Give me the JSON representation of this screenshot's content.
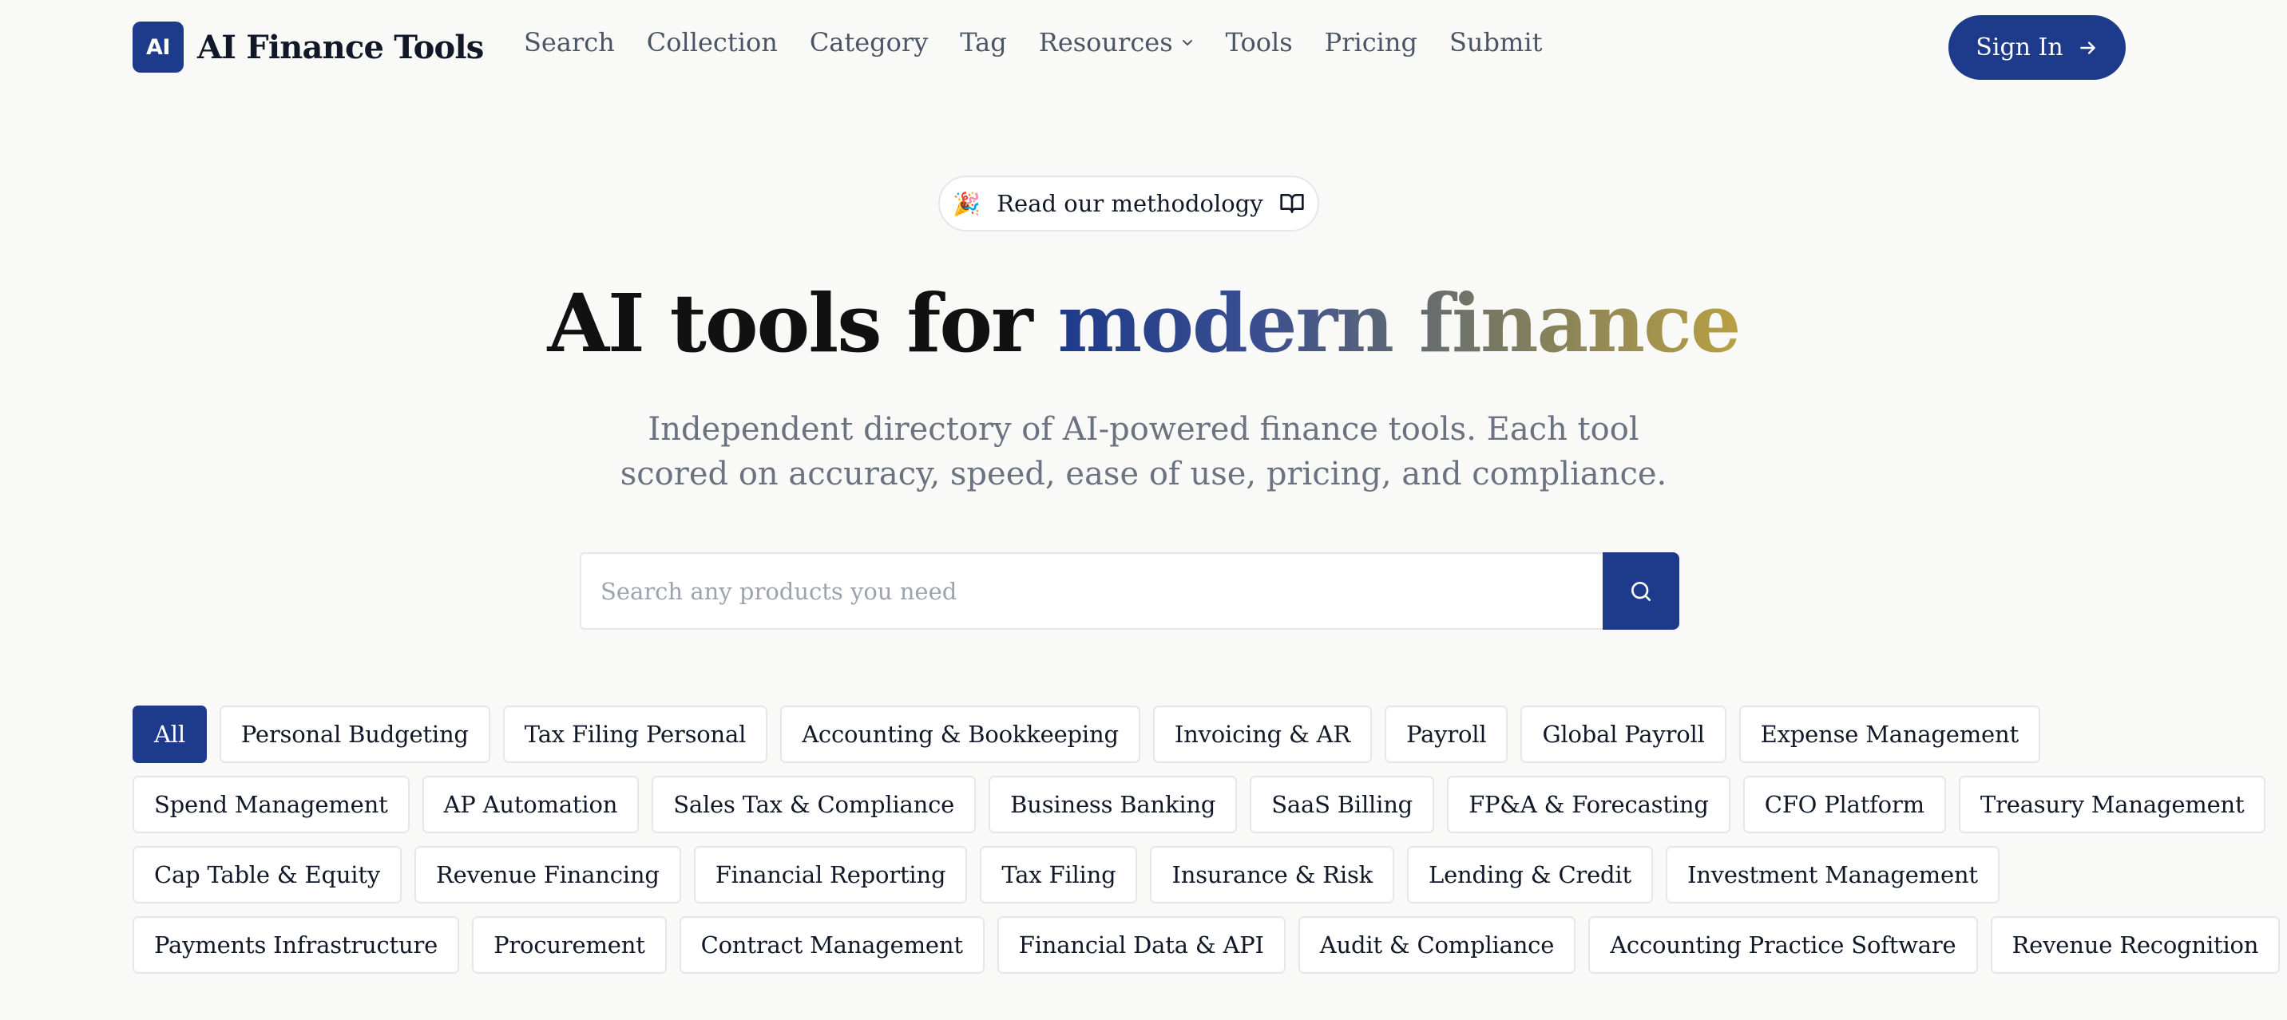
{
  "brand": {
    "badge": "AI",
    "name": "AI Finance Tools",
    "accent": "#1e3a8a"
  },
  "nav": {
    "items": [
      {
        "label": "Search"
      },
      {
        "label": "Collection"
      },
      {
        "label": "Category"
      },
      {
        "label": "Tag"
      },
      {
        "label": "Resources",
        "icon": "chevron-down-icon"
      },
      {
        "label": "Tools"
      },
      {
        "label": "Pricing"
      },
      {
        "label": "Submit"
      }
    ],
    "signin_label": "Sign In",
    "signin_icon": "arrow-right-icon"
  },
  "hero": {
    "pill_emoji": "🎉",
    "pill_label": "Read our methodology",
    "pill_icon": "book-open-icon",
    "title_plain": "AI tools for ",
    "title_highlight": "modern finance",
    "subtitle_line1": "Independent directory of AI-powered finance tools. Each tool",
    "subtitle_line2": "scored on accuracy, speed, ease of use, pricing, and compliance.",
    "gradient_colors": [
      "#1e3a8a",
      "#b8a043"
    ]
  },
  "search": {
    "placeholder": "Search any products you need",
    "value": "",
    "button_icon": "search-icon"
  },
  "categories": {
    "rows": [
      [
        "All",
        "Personal Budgeting",
        "Tax Filing Personal",
        "Accounting & Bookkeeping",
        "Invoicing & AR",
        "Payroll",
        "Global Payroll",
        "Expense Management"
      ],
      [
        "Spend Management",
        "AP Automation",
        "Sales Tax & Compliance",
        "Business Banking",
        "SaaS Billing",
        "FP&A & Forecasting",
        "CFO Platform",
        "Treasury Management"
      ],
      [
        "Cap Table & Equity",
        "Revenue Financing",
        "Financial Reporting",
        "Tax Filing",
        "Insurance & Risk",
        "Lending & Credit",
        "Investment Management"
      ],
      [
        "Payments Infrastructure",
        "Procurement",
        "Contract Management",
        "Financial Data & API",
        "Audit & Compliance",
        "Accounting Practice Software",
        "Revenue Recognition"
      ]
    ],
    "selected": "All"
  }
}
